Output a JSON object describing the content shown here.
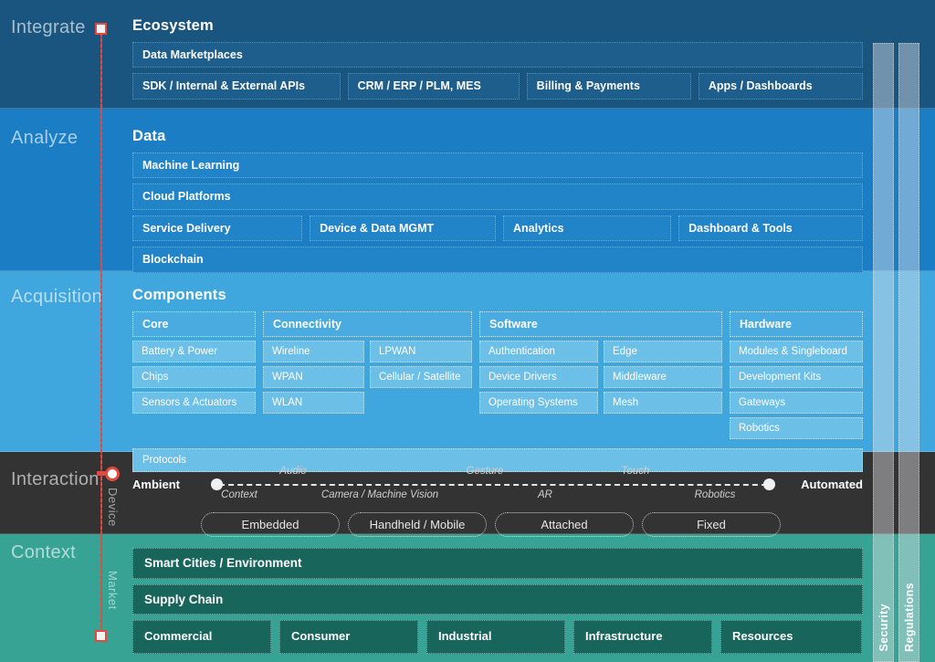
{
  "stages": {
    "integrate": "Integrate",
    "analyze": "Analyze",
    "acquisition": "Acquisition",
    "interaction": "Interaction",
    "context": "Context"
  },
  "axis": {
    "device_label": "Device",
    "market_label": "Market",
    "color": "#e24a3f"
  },
  "side_bars": [
    {
      "label": "Security"
    },
    {
      "label": "Regulations"
    }
  ],
  "ecosystem": {
    "title": "Ecosystem",
    "full_width": "Data Marketplaces",
    "items": [
      "SDK / Internal & External APIs",
      "CRM / ERP / PLM, MES",
      "Billing & Payments",
      "Apps / Dashboards"
    ]
  },
  "data": {
    "title": "Data",
    "machine_learning": "Machine Learning",
    "cloud_platforms": "Cloud Platforms",
    "middle_items": [
      "Service Delivery",
      "Device & Data MGMT",
      "Analytics",
      "Dashboard & Tools"
    ],
    "blockchain": "Blockchain"
  },
  "components": {
    "title": "Components",
    "groups": [
      {
        "head": "Core",
        "columns": [
          [
            "Battery & Power",
            "Chips",
            "Sensors & Actuators"
          ]
        ]
      },
      {
        "head": "Connectivity",
        "columns": [
          [
            "Wireline",
            "WPAN",
            "WLAN"
          ],
          [
            "LPWAN",
            "Cellular / Satellite"
          ]
        ]
      },
      {
        "head": "Software",
        "columns": [
          [
            "Authentication",
            "Device Drivers",
            "Operating Systems"
          ],
          [
            "Edge",
            "Middleware",
            "Mesh"
          ]
        ]
      },
      {
        "head": "Hardware",
        "columns": [
          [
            "Modules & Singleboard",
            "Development Kits",
            "Gateways",
            "Robotics"
          ]
        ]
      }
    ],
    "protocols": "Protocols"
  },
  "interaction": {
    "left_end": "Ambient",
    "right_end": "Automated",
    "above_labels": [
      "Audio",
      "Gesture",
      "Touch"
    ],
    "below_labels": [
      "Context",
      "Camera / Machine Vision",
      "AR",
      "Robotics"
    ],
    "pills": [
      "Embedded",
      "Handheld / Mobile",
      "Attached",
      "Fixed"
    ]
  },
  "context": {
    "smart_cities": "Smart Cities / Environment",
    "supply_chain": "Supply Chain",
    "markets": [
      "Commercial",
      "Consumer",
      "Industrial",
      "Infrastructure",
      "Resources"
    ]
  }
}
